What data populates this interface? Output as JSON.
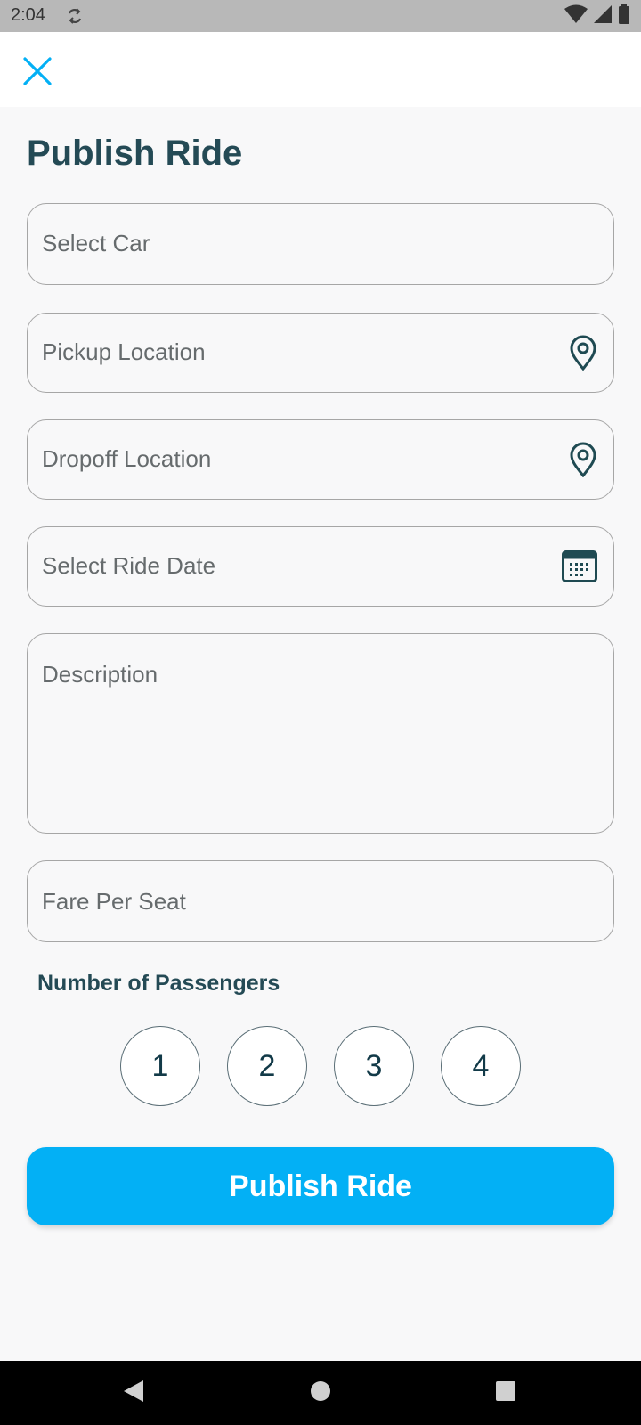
{
  "status_bar": {
    "time": "2:04",
    "icons": [
      "sync-icon",
      "wifi-icon",
      "signal-icon",
      "battery-icon"
    ]
  },
  "header": {
    "close_icon": "close-icon",
    "title": "Publish Ride"
  },
  "form": {
    "select_car": {
      "placeholder": "Select Car"
    },
    "pickup": {
      "placeholder": "Pickup Location",
      "icon": "location-pin-icon"
    },
    "dropoff": {
      "placeholder": "Dropoff Location",
      "icon": "location-pin-icon"
    },
    "ride_date": {
      "placeholder": "Select Ride Date",
      "icon": "calendar-icon"
    },
    "description": {
      "placeholder": "Description"
    },
    "fare": {
      "placeholder": "Fare Per Seat"
    }
  },
  "passengers": {
    "label": "Number of Passengers",
    "options": [
      "1",
      "2",
      "3",
      "4"
    ]
  },
  "publish_button": {
    "label": "Publish Ride"
  },
  "colors": {
    "accent": "#03b0f5",
    "heading": "#244a55",
    "icon": "#1f4a52",
    "background": "#f8f8f9"
  }
}
